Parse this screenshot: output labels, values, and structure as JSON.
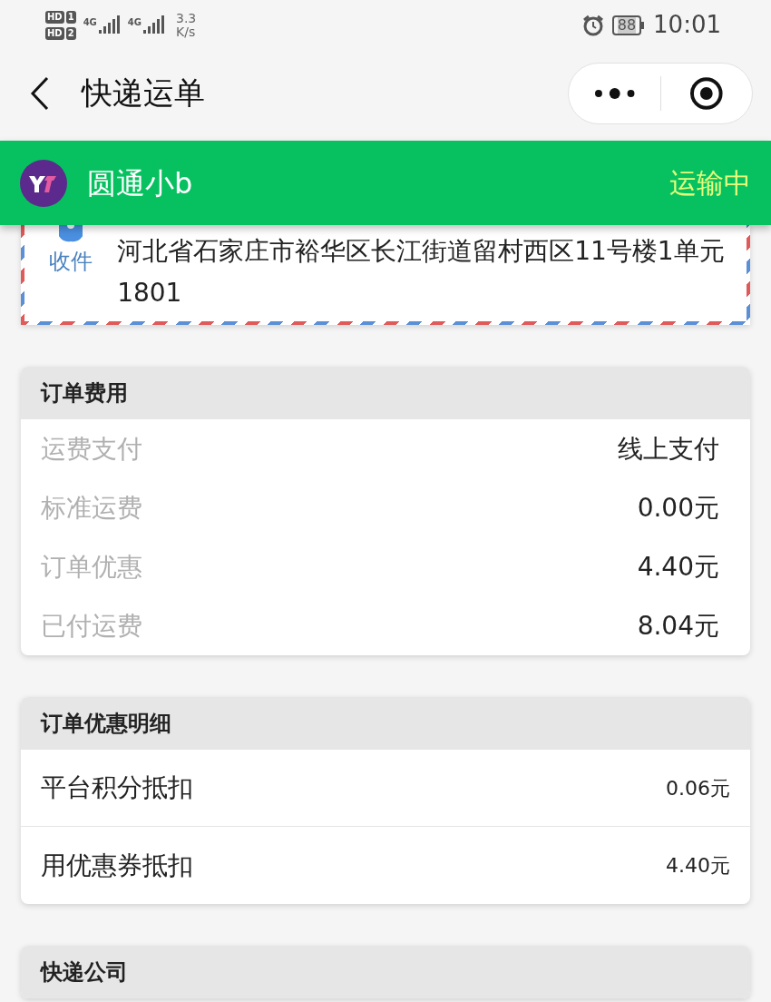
{
  "status_bar": {
    "sims": [
      {
        "label": "HD",
        "slot": "1"
      },
      {
        "label": "HD",
        "slot": "2"
      }
    ],
    "networks": [
      "4G",
      "4G"
    ],
    "speed": "3.3",
    "speed_unit": "K/s",
    "battery": "88",
    "time": "10:01"
  },
  "nav": {
    "title": "快递运单"
  },
  "carrier": {
    "name": "圆通小b",
    "status": "运输中"
  },
  "address": {
    "tag": "收件",
    "text": "河北省石家庄市裕华区长江街道留村西区11号楼1单元1801"
  },
  "sections": [
    {
      "title": "订单费用",
      "kind": "plain",
      "rows": [
        {
          "label": "运费支付",
          "value": "线上支付"
        },
        {
          "label": "标准运费",
          "value": "0.00元"
        },
        {
          "label": "订单优惠",
          "value": "4.40元"
        },
        {
          "label": "已付运费",
          "value": "8.04元"
        }
      ]
    },
    {
      "title": "订单优惠明细",
      "kind": "divided",
      "rows": [
        {
          "label": "平台积分抵扣",
          "value": "0.06元"
        },
        {
          "label": "用优惠券抵扣",
          "value": "4.40元"
        }
      ]
    },
    {
      "title": "快递公司"
    }
  ]
}
